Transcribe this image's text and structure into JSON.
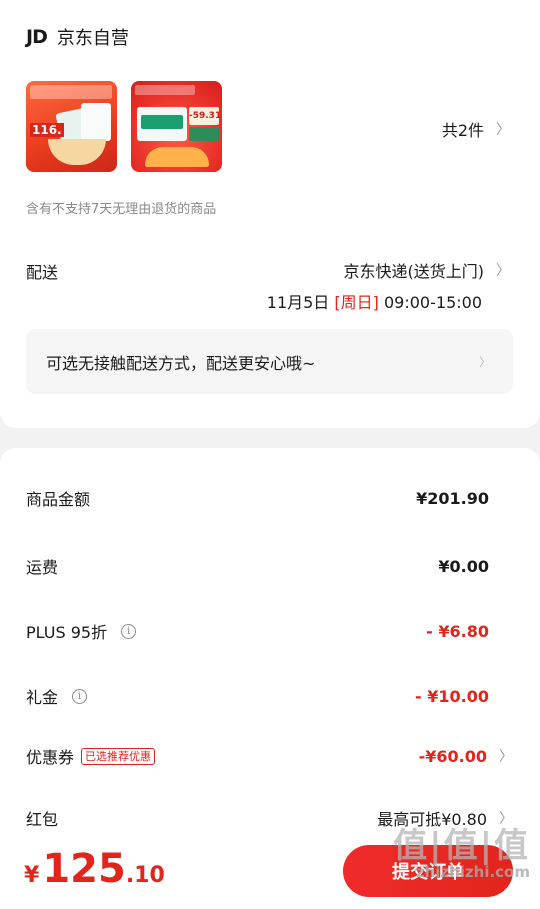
{
  "store": {
    "logo": "JD",
    "name": "京东自营"
  },
  "products": {
    "count_label": "共2件",
    "notice": "含有不支持7天无理由退货的商品"
  },
  "thumbs": {
    "thumb1_price": "116.",
    "thumb2_tag": "-59.31"
  },
  "delivery": {
    "label": "配送",
    "method": "京东快递(送货上门)",
    "date": "11月5日",
    "day": "[周日]",
    "time": "09:00-15:00",
    "contactless": "可选无接触配送方式，配送更安心哦~"
  },
  "summary": {
    "goods_amount": {
      "label": "商品金额",
      "value": "¥201.90"
    },
    "shipping": {
      "label": "运费",
      "value": "¥0.00"
    },
    "plus": {
      "label": "PLUS 95折",
      "value": "- ¥6.80"
    },
    "gift": {
      "label": "礼金",
      "value": "- ¥10.00"
    },
    "coupon": {
      "label": "优惠券",
      "badge": "已选推荐优惠",
      "value": "-¥60.00"
    },
    "redpacket": {
      "label": "红包",
      "value": "最高可抵¥0.80"
    }
  },
  "footer": {
    "currency": "¥",
    "total_int": "125",
    "total_dec": ".10",
    "submit_label": "提交订单"
  },
  "watermark": {
    "text": "值|值|值",
    "url": "zhizhizhi.com"
  },
  "colors": {
    "accent": "#e1251b",
    "background": "#f2f2f2",
    "card": "#ffffff"
  }
}
